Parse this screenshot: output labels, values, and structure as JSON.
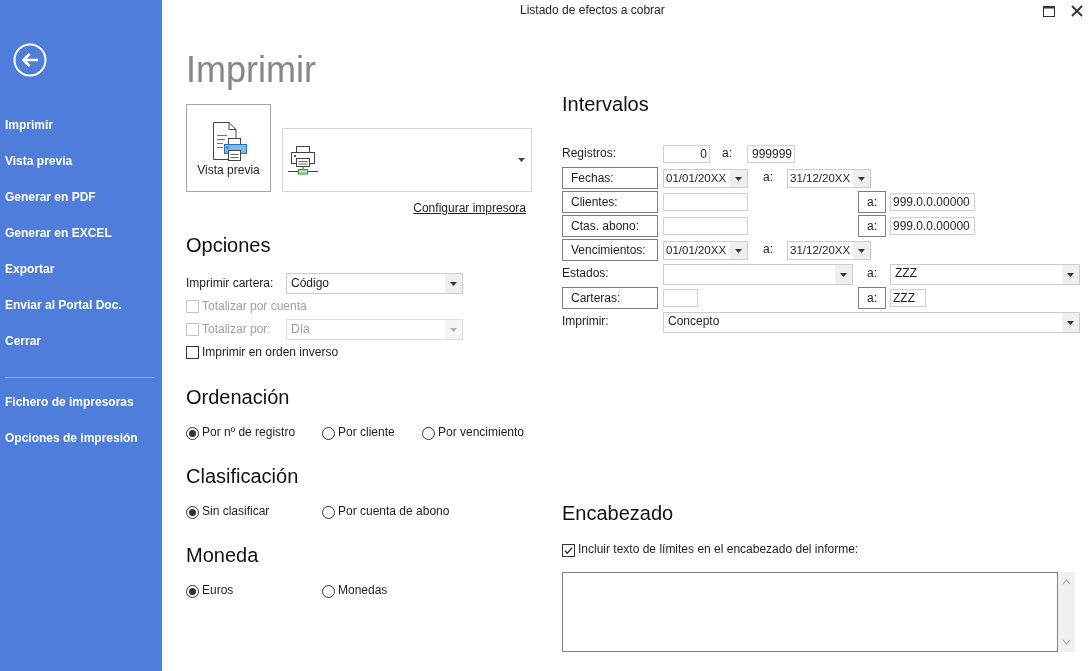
{
  "window": {
    "title": "Listado de efectos a cobrar"
  },
  "sidebar": {
    "items": [
      {
        "label": "Imprimir"
      },
      {
        "label": "Vista previa"
      },
      {
        "label": "Generar en PDF"
      },
      {
        "label": "Generar en EXCEL"
      },
      {
        "label": "Exportar"
      },
      {
        "label": "Enviar al Portal Doc."
      },
      {
        "label": "Cerrar"
      }
    ],
    "footer_items": [
      {
        "label": "Fichero de impresoras"
      },
      {
        "label": "Opciones de impresión"
      }
    ]
  },
  "page_title": "Imprimir",
  "preview_button": {
    "label": "Vista previa"
  },
  "configure_printer_link": "Configurar impresora",
  "options": {
    "title": "Opciones",
    "rows": [
      {
        "kind": "select",
        "label": "Imprimir cartera:",
        "value": "Código",
        "disabled": false
      },
      {
        "kind": "checkbox",
        "label": "Totalizar por cuenta",
        "checked": false,
        "disabled": true
      },
      {
        "kind": "checkbox-select",
        "label": "Totalizar por:",
        "checked": false,
        "disabled": true,
        "value": "Día"
      },
      {
        "kind": "checkbox",
        "label": "Imprimir en orden inverso",
        "checked": false,
        "disabled": false
      }
    ]
  },
  "radio_groups": [
    {
      "title": "Ordenación",
      "options": [
        {
          "label": "Por nº de registro",
          "selected": true
        },
        {
          "label": "Por cliente",
          "selected": false
        },
        {
          "label": "Por vencimiento",
          "selected": false
        }
      ]
    },
    {
      "title": "Clasificación",
      "options": [
        {
          "label": "Sin clasificar",
          "selected": true
        },
        {
          "label": "Por cuenta de abono",
          "selected": false
        }
      ]
    },
    {
      "title": "Moneda",
      "options": [
        {
          "label": "Euros",
          "selected": true
        },
        {
          "label": "Monedas",
          "selected": false
        }
      ]
    }
  ],
  "intervals": {
    "title": "Intervalos",
    "rows": [
      {
        "kind": "number",
        "label": "Registros:",
        "label_button": false,
        "from": "0",
        "to_label": "a:",
        "to_button": false,
        "to": "999999"
      },
      {
        "kind": "date",
        "label": "Fechas:",
        "label_button": true,
        "from": "01/01/20XX",
        "to_label": "a:",
        "to_button": false,
        "to": "31/12/20XX"
      },
      {
        "kind": "account",
        "label": "Clientes:",
        "label_button": true,
        "to_label": "a:",
        "to_button": true,
        "to": "999.0.0.00000"
      },
      {
        "kind": "account",
        "label": "Ctas. abono:",
        "label_button": true,
        "to_label": "a:",
        "to_button": true,
        "to": "999.0.0.00000"
      },
      {
        "kind": "date",
        "label": "Vencimientos:",
        "label_button": true,
        "from": "01/01/20XX",
        "to_label": "a:",
        "to_button": false,
        "to": "31/12/20XX"
      },
      {
        "kind": "select",
        "label": "Estados:",
        "label_button": false,
        "to_label": "a:",
        "to_button": false,
        "to": "ZZZ"
      },
      {
        "kind": "code",
        "label": "Carteras:",
        "label_button": true,
        "to_label": "a:",
        "to_button": true,
        "to": "ZZZ"
      },
      {
        "kind": "wide-select",
        "label": "Imprimir:",
        "label_button": false,
        "value": "Concepto"
      }
    ]
  },
  "header": {
    "title": "Encabezado",
    "include_limits": {
      "label": "Incluir texto de límites en el encabezado del informe:",
      "checked": true
    }
  }
}
